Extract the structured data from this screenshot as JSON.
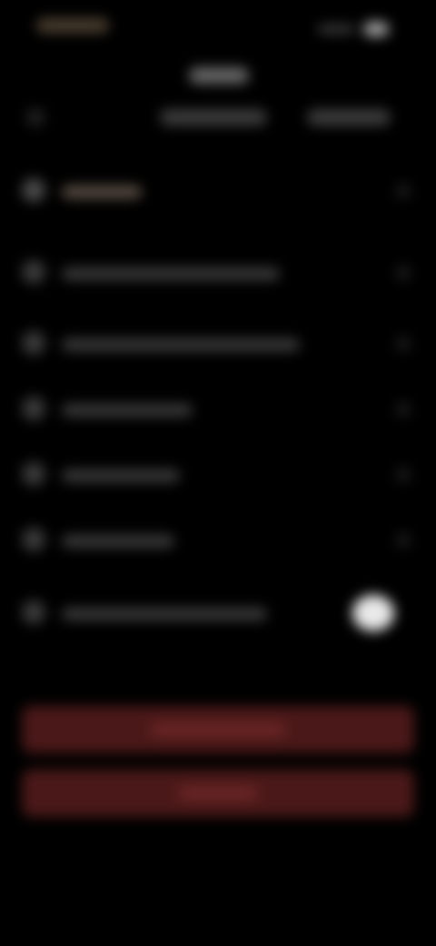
{
  "colors": {
    "background": "#000000",
    "row_text": "#9a9a9a",
    "accent_brown": "#5b4f44",
    "button_fill": "#4a1818",
    "button_label": "#d68f8f",
    "toggle_on": "#e9e9e9"
  },
  "header": {
    "back_icon": "chevron-left-icon",
    "title": "",
    "tabs": [
      "",
      ""
    ]
  },
  "list": {
    "items": [
      {
        "icon": "circle-icon",
        "label": ""
      },
      {
        "icon": "circle-icon",
        "label": ""
      },
      {
        "icon": "circle-icon",
        "label": ""
      },
      {
        "icon": "circle-icon",
        "label": ""
      },
      {
        "icon": "circle-icon",
        "label": ""
      },
      {
        "icon": "circle-icon",
        "label": ""
      },
      {
        "icon": "circle-icon",
        "label": "",
        "toggle": "on"
      }
    ]
  },
  "actions": {
    "primary_label": "",
    "secondary_label": ""
  }
}
